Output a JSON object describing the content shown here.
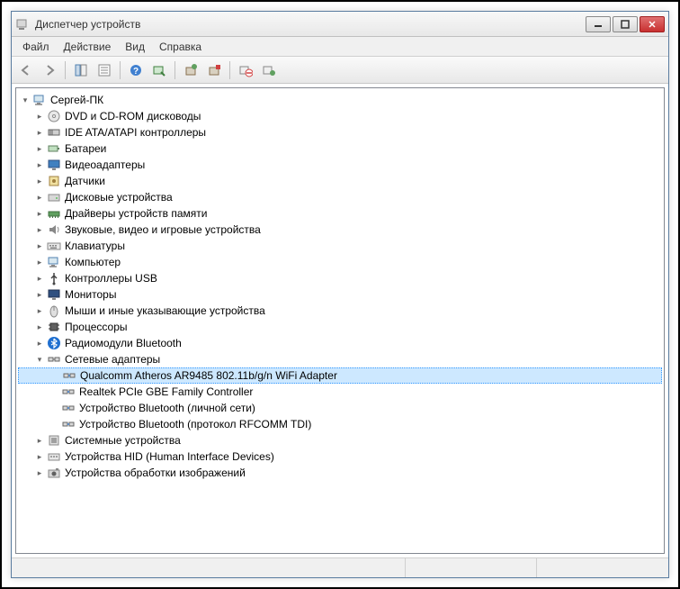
{
  "window": {
    "title": "Диспетчер устройств"
  },
  "menu": {
    "file": "Файл",
    "action": "Действие",
    "view": "Вид",
    "help": "Справка"
  },
  "tree": {
    "root": "Сергей-ПК",
    "categories": [
      {
        "label": "DVD и CD-ROM дисководы",
        "icon": "disc"
      },
      {
        "label": "IDE ATA/ATAPI контроллеры",
        "icon": "ide"
      },
      {
        "label": "Батареи",
        "icon": "battery"
      },
      {
        "label": "Видеоадаптеры",
        "icon": "display"
      },
      {
        "label": "Датчики",
        "icon": "sensor"
      },
      {
        "label": "Дисковые устройства",
        "icon": "drive"
      },
      {
        "label": "Драйверы устройств памяти",
        "icon": "memory"
      },
      {
        "label": "Звуковые, видео и игровые устройства",
        "icon": "sound"
      },
      {
        "label": "Клавиатуры",
        "icon": "keyboard"
      },
      {
        "label": "Компьютер",
        "icon": "computer"
      },
      {
        "label": "Контроллеры USB",
        "icon": "usb"
      },
      {
        "label": "Мониторы",
        "icon": "monitor"
      },
      {
        "label": "Мыши и иные указывающие устройства",
        "icon": "mouse"
      },
      {
        "label": "Процессоры",
        "icon": "cpu"
      },
      {
        "label": "Радиомодули Bluetooth",
        "icon": "bluetooth"
      },
      {
        "label": "Сетевые адаптеры",
        "icon": "network",
        "expanded": true,
        "children": [
          {
            "label": "Qualcomm Atheros AR9485 802.11b/g/n WiFi Adapter",
            "icon": "netadapter",
            "selected": true
          },
          {
            "label": "Realtek PCIe GBE Family Controller",
            "icon": "netadapter"
          },
          {
            "label": "Устройство Bluetooth (личной сети)",
            "icon": "netadapter"
          },
          {
            "label": "Устройство Bluetooth (протокол RFCOMM TDI)",
            "icon": "netadapter"
          }
        ]
      },
      {
        "label": "Системные устройства",
        "icon": "system"
      },
      {
        "label": "Устройства HID (Human Interface Devices)",
        "icon": "hid"
      },
      {
        "label": "Устройства обработки изображений",
        "icon": "imaging"
      }
    ]
  }
}
